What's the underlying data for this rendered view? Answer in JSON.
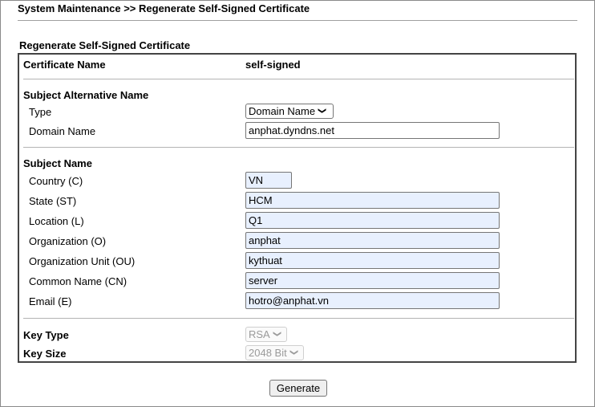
{
  "header": {
    "breadcrumb": "System Maintenance >> Regenerate Self-Signed Certificate",
    "section_title": "Regenerate Self-Signed Certificate"
  },
  "certificate": {
    "name_label": "Certificate Name",
    "name_value": "self-signed"
  },
  "san": {
    "heading": "Subject Alternative Name",
    "type_label": "Type",
    "type_selected": "Domain Name",
    "domain_label": "Domain Name",
    "domain_value": "anphat.dyndns.net"
  },
  "subject": {
    "heading": "Subject Name",
    "country_label": "Country (C)",
    "country_value": "VN",
    "state_label": "State (ST)",
    "state_value": "HCM",
    "location_label": "Location (L)",
    "location_value": "Q1",
    "org_label": "Organization (O)",
    "org_value": "anphat",
    "org_unit_label": "Organization Unit (OU)",
    "org_unit_value": "kythuat",
    "common_name_label": "Common Name (CN)",
    "common_name_value": "server",
    "email_label": "Email (E)",
    "email_value": "hotro@anphat.vn"
  },
  "key": {
    "type_label": "Key Type",
    "type_selected": "RSA",
    "size_label": "Key Size",
    "size_selected": "2048 Bit"
  },
  "actions": {
    "generate_label": "Generate"
  },
  "icons": {
    "dropdown": "chevron-down-icon"
  }
}
